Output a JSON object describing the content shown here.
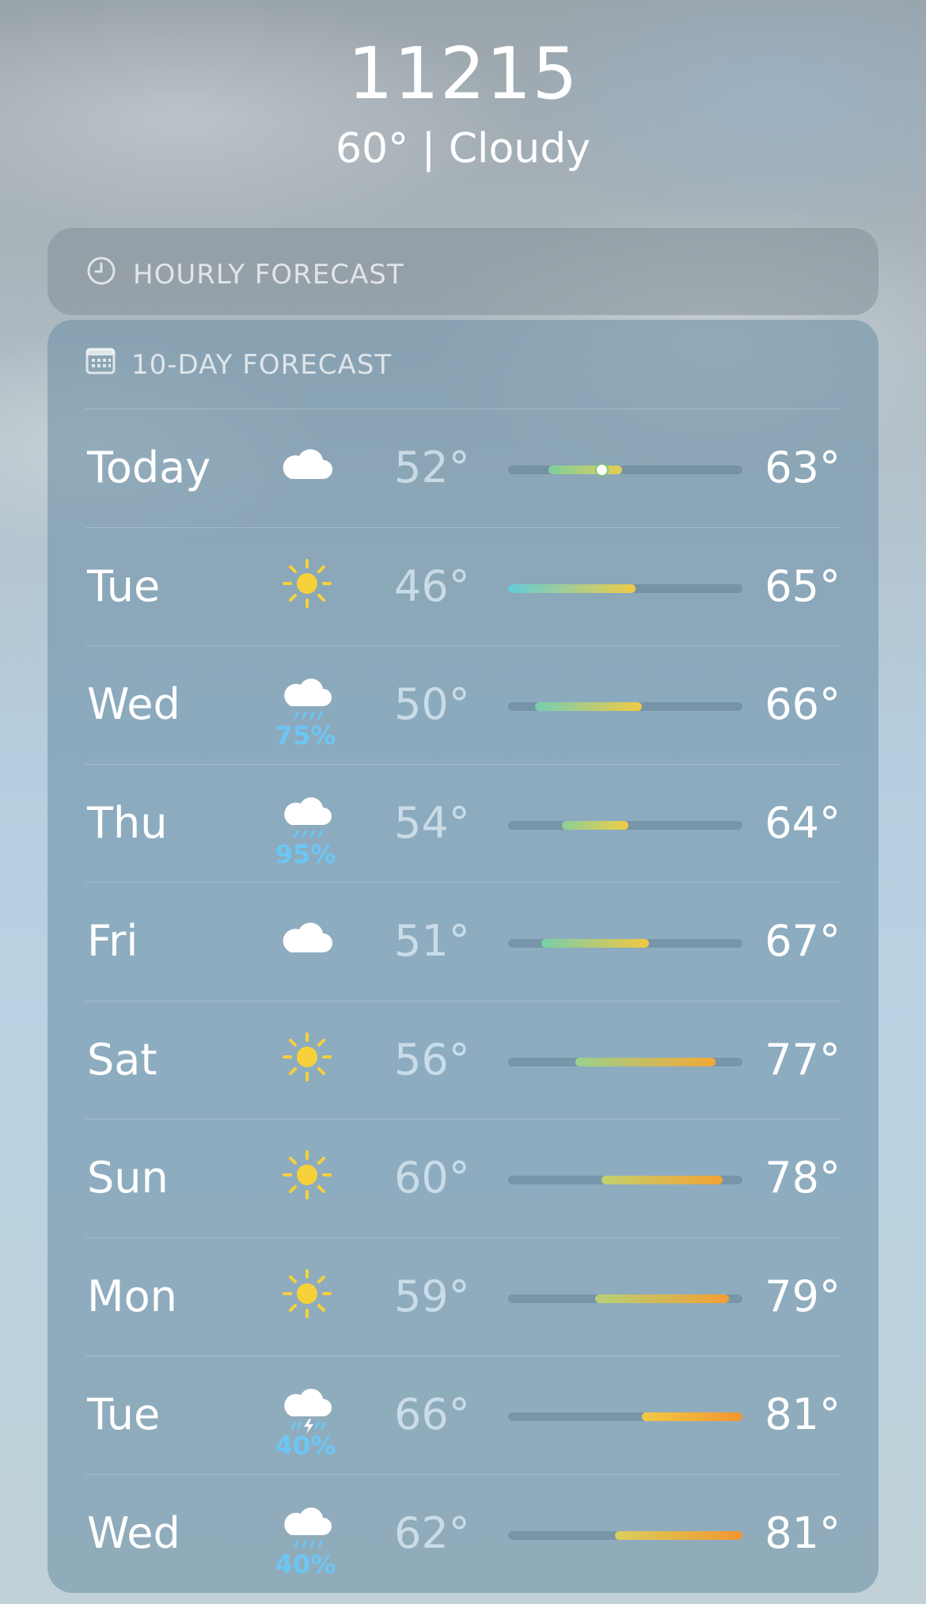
{
  "header": {
    "location": "11215",
    "summary": "60° | Cloudy"
  },
  "hourly": {
    "title": "HOURLY FORECAST",
    "icon": "clock-icon"
  },
  "daily": {
    "title": "10-DAY FORECAST",
    "icon": "calendar-icon",
    "range_low": 46,
    "range_high": 81,
    "current_temp": 60,
    "rows": [
      {
        "day": "Today",
        "icon": "cloud-icon",
        "pop": "",
        "low": "52°",
        "high": "63°",
        "lo": 52,
        "hi": 63,
        "current": true
      },
      {
        "day": "Tue",
        "icon": "sun-icon",
        "pop": "",
        "low": "46°",
        "high": "65°",
        "lo": 46,
        "hi": 65
      },
      {
        "day": "Wed",
        "icon": "rain-icon",
        "pop": "75%",
        "low": "50°",
        "high": "66°",
        "lo": 50,
        "hi": 66
      },
      {
        "day": "Thu",
        "icon": "rain-icon",
        "pop": "95%",
        "low": "54°",
        "high": "64°",
        "lo": 54,
        "hi": 64
      },
      {
        "day": "Fri",
        "icon": "cloud-icon",
        "pop": "",
        "low": "51°",
        "high": "67°",
        "lo": 51,
        "hi": 67
      },
      {
        "day": "Sat",
        "icon": "sun-icon",
        "pop": "",
        "low": "56°",
        "high": "77°",
        "lo": 56,
        "hi": 77
      },
      {
        "day": "Sun",
        "icon": "sun-icon",
        "pop": "",
        "low": "60°",
        "high": "78°",
        "lo": 60,
        "hi": 78
      },
      {
        "day": "Mon",
        "icon": "sun-icon",
        "pop": "",
        "low": "59°",
        "high": "79°",
        "lo": 59,
        "hi": 79
      },
      {
        "day": "Tue",
        "icon": "thunderstorm-icon",
        "pop": "40%",
        "low": "66°",
        "high": "81°",
        "lo": 66,
        "hi": 81
      },
      {
        "day": "Wed",
        "icon": "rain-icon",
        "pop": "40%",
        "low": "62°",
        "high": "81°",
        "lo": 62,
        "hi": 81
      }
    ]
  },
  "colors": {
    "precip": "#6cc6f5",
    "sun": "#f7d13a"
  }
}
